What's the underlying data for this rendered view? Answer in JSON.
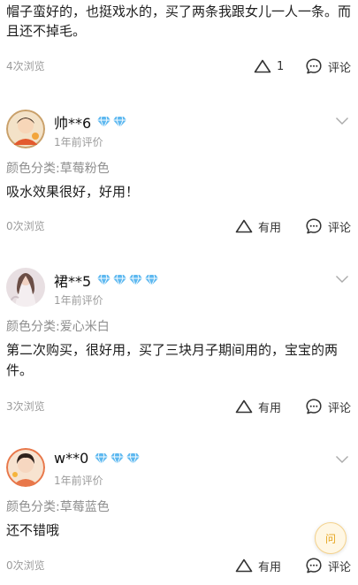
{
  "top_review": {
    "text": "帽子蛮好的，也挺戏水的，买了两条我跟女儿一人一条。而且还不掉毛。",
    "views": "4次浏览",
    "like_count": "1",
    "comment_label": "评论"
  },
  "reviews": [
    {
      "username": "帅**6",
      "diamonds": 2,
      "date": "1年前评价",
      "sku": "颜色分类:草莓粉色",
      "content": "吸水效果很好，好用！",
      "views": "0次浏览",
      "useful_label": "有用",
      "comment_label": "评论"
    },
    {
      "username": "裙**5",
      "diamonds": 4,
      "date": "1年前评价",
      "sku": "颜色分类:爱心米白",
      "content": "第二次购买，很好用，买了三块月子期间用的，宝宝的两件。",
      "views": "3次浏览",
      "useful_label": "有用",
      "comment_label": "评论"
    },
    {
      "username": "w**0",
      "diamonds": 3,
      "date": "1年前评价",
      "sku": "颜色分类:草莓蓝色",
      "content": "还不错哦",
      "views": "0次浏览",
      "useful_label": "有用",
      "comment_label": "评论"
    }
  ],
  "ask_button": {
    "label": "问"
  },
  "icons": {
    "like": "thumb-triangle-icon",
    "comment": "comment-bubble-icon",
    "expand": "chevron-down-icon",
    "level": "diamond-icon"
  },
  "colors": {
    "diamond": "#5db8f0",
    "muted_text": "#9b9b9b",
    "ask_accent": "#e6a520"
  }
}
